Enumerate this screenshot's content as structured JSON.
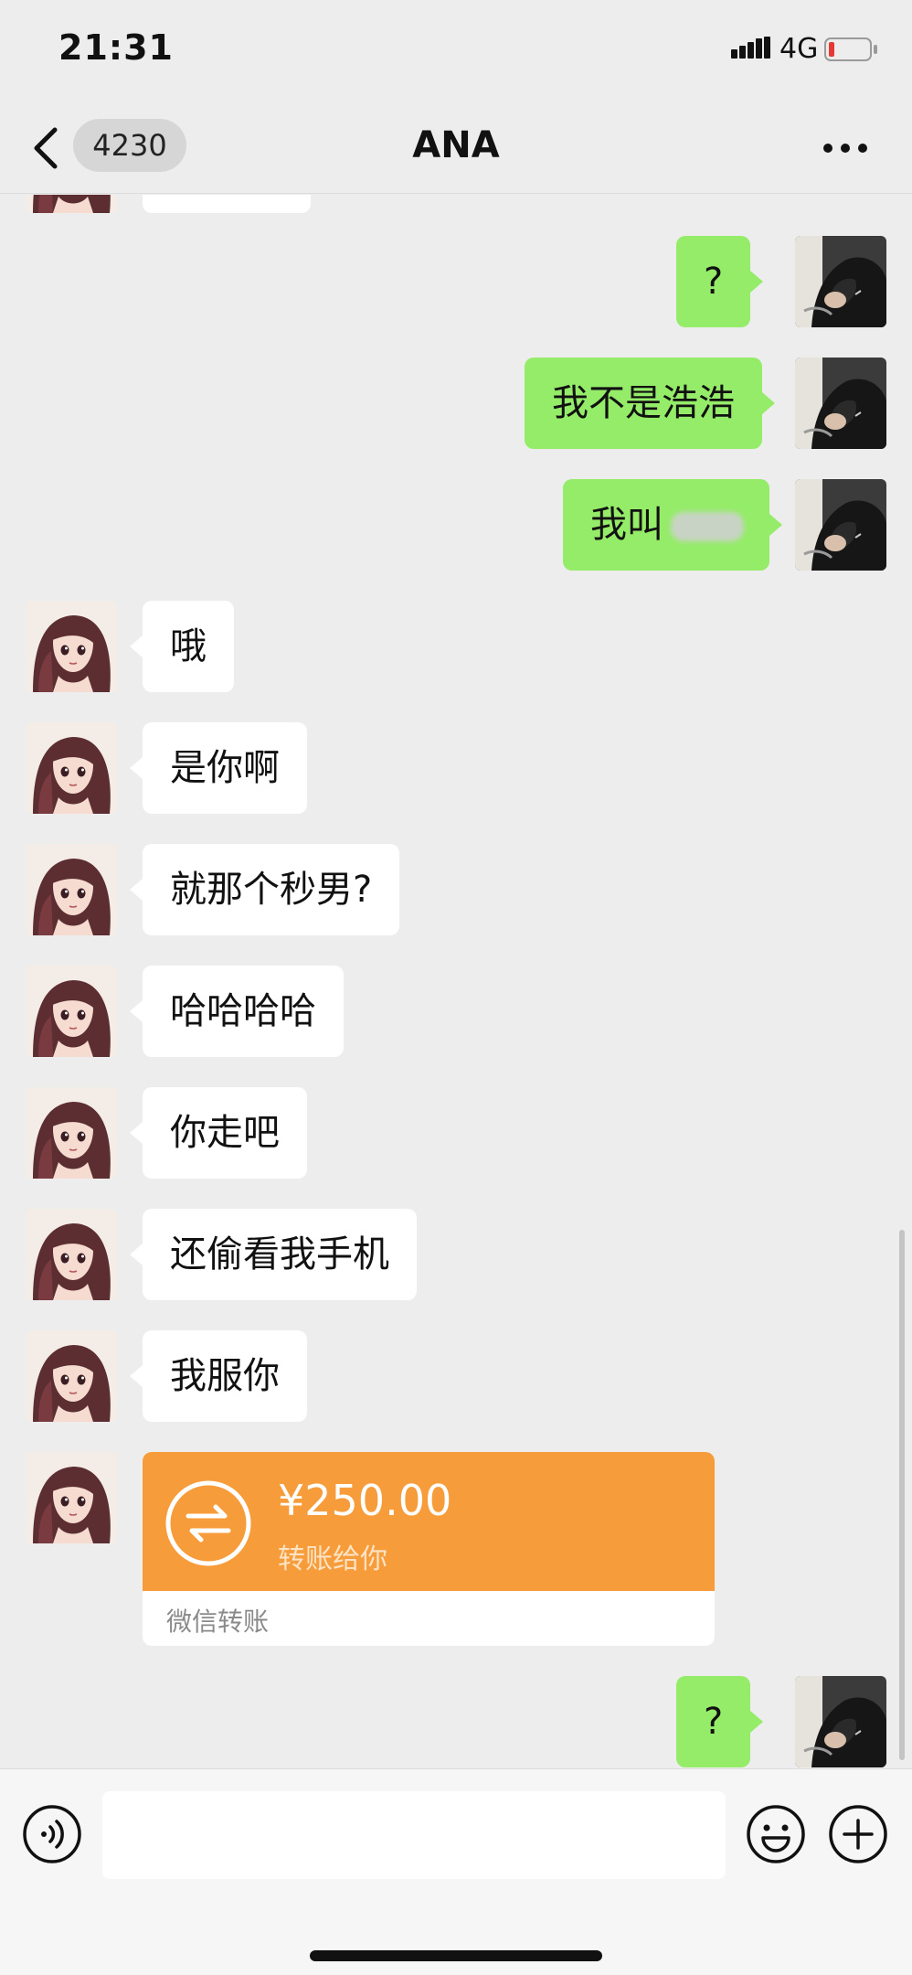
{
  "status_bar": {
    "time": "21:31",
    "network": "4G",
    "icons": [
      "signal-icon",
      "battery-icon"
    ]
  },
  "header": {
    "back_icon": "chevron-left-icon",
    "unread_count": "4230",
    "title": "ANA",
    "more_icon": "more-dots-icon"
  },
  "messages": [
    {
      "side": "in",
      "type": "text",
      "text": ""
    },
    {
      "side": "out",
      "type": "text",
      "text": "?"
    },
    {
      "side": "out",
      "type": "text",
      "text": "我不是浩浩"
    },
    {
      "side": "out",
      "type": "text",
      "text": "我叫",
      "redacted": true
    },
    {
      "side": "in",
      "type": "text",
      "text": "哦"
    },
    {
      "side": "in",
      "type": "text",
      "text": "是你啊"
    },
    {
      "side": "in",
      "type": "text",
      "text": "就那个秒男?"
    },
    {
      "side": "in",
      "type": "text",
      "text": "哈哈哈哈"
    },
    {
      "side": "in",
      "type": "text",
      "text": "你走吧"
    },
    {
      "side": "in",
      "type": "text",
      "text": "还偷看我手机"
    },
    {
      "side": "in",
      "type": "text",
      "text": "我服你"
    },
    {
      "side": "in",
      "type": "transfer",
      "amount": "¥250.00",
      "note": "转账给你",
      "source": "微信转账"
    },
    {
      "side": "out",
      "type": "text",
      "text": "?"
    }
  ],
  "input_bar": {
    "voice_icon": "voice-icon",
    "input_value": "",
    "emoji_icon": "emoji-icon",
    "plus_icon": "plus-icon"
  },
  "colors": {
    "background": "#ededed",
    "incoming_bubble": "#ffffff",
    "outgoing_bubble": "#95ec69",
    "transfer_card": "#f79c3a"
  }
}
